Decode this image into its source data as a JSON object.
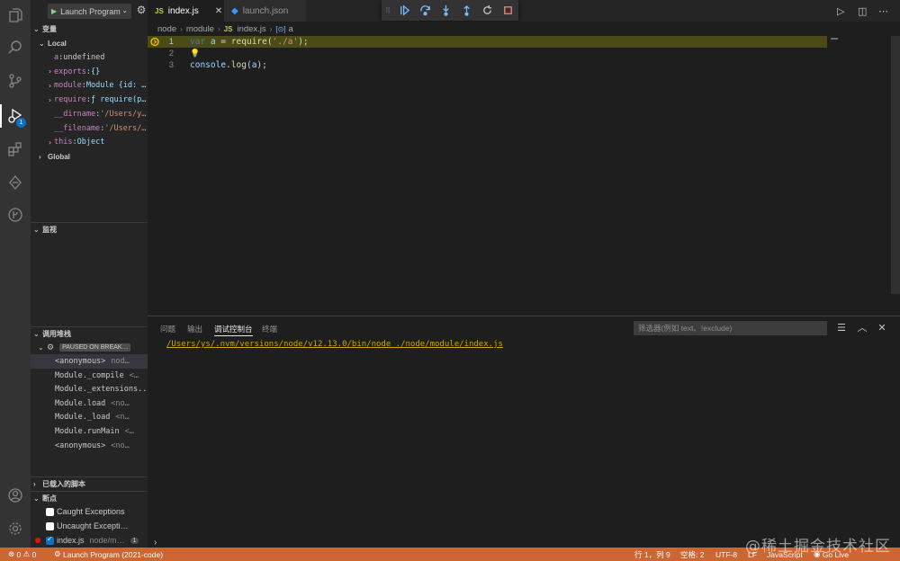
{
  "activity_bar": {
    "items": [
      {
        "icon": "files-icon"
      },
      {
        "icon": "search-icon"
      },
      {
        "icon": "source-control-icon"
      },
      {
        "icon": "run-debug-icon",
        "badge": "1"
      },
      {
        "icon": "extensions-icon"
      },
      {
        "icon": "remote-explorer-icon"
      },
      {
        "icon": "git-graph-icon"
      }
    ],
    "bottom": [
      {
        "icon": "account-icon"
      },
      {
        "icon": "manage-gear-icon"
      }
    ]
  },
  "debug": {
    "config_label": "Launch Program",
    "variables_title": "变量",
    "local_title": "Local",
    "global_title": "Global",
    "variables": [
      {
        "name": "a",
        "sep": ": ",
        "value": "undefined",
        "expandable": false
      },
      {
        "name": "exports",
        "sep": ": ",
        "value": "{}",
        "expandable": true
      },
      {
        "name": "module",
        "sep": ": ",
        "value": "Module {id: …",
        "expandable": true
      },
      {
        "name": "require",
        "sep": ": ",
        "value": "ƒ require(p…",
        "expandable": true
      },
      {
        "name": "__dirname",
        "sep": ": ",
        "value": "'/Users/y…",
        "expandable": false
      },
      {
        "name": "__filename",
        "sep": ": ",
        "value": "'/Users/…",
        "expandable": false
      },
      {
        "name": "this",
        "sep": ": ",
        "value": "Object",
        "expandable": true
      }
    ],
    "watch_title": "监视",
    "callstack_title": "调用堆栈",
    "paused_label": "PAUSED ON BREAK…",
    "frames": [
      {
        "fn": "<anonymous>",
        "src": "nod…"
      },
      {
        "fn": "Module._compile",
        "src": "<…"
      },
      {
        "fn": "Module._extensions..js",
        "src": ""
      },
      {
        "fn": "Module.load",
        "src": "<no…"
      },
      {
        "fn": "Module._load",
        "src": "<n…"
      },
      {
        "fn": "Module.runMain",
        "src": "<…"
      },
      {
        "fn": "<anonymous>",
        "src": "<no…"
      }
    ],
    "loaded_scripts_title": "已载入的脚本",
    "breakpoints_title": "断点",
    "breakpoints": [
      {
        "label": "Caught Exceptions",
        "checked": false
      },
      {
        "label": "Uncaught Excepti…",
        "checked": false
      },
      {
        "label": "index.js",
        "path": "node/m…",
        "count": "1",
        "checked": true
      }
    ]
  },
  "tabs": [
    {
      "label": "index.js",
      "type": "JS",
      "active": true
    },
    {
      "label": "launch.json",
      "type": "vscode",
      "active": false
    }
  ],
  "breadcrumb": [
    "node",
    "module",
    "index.js",
    "a"
  ],
  "editor": {
    "lines": [
      {
        "num": "1",
        "code": "var a = require('./a');"
      },
      {
        "num": "2",
        "code": ""
      },
      {
        "num": "3",
        "code": "console.log(a);"
      }
    ]
  },
  "panel": {
    "tabs": [
      "问题",
      "输出",
      "调试控制台",
      "终端"
    ],
    "active_tab": "调试控制台",
    "filter_placeholder": "筛选器(例如 text、!exclude)",
    "console_output": "/Users/ys/.nvm/versions/node/v12.13.0/bin/node ./node/module/index.js",
    "prompt": "›"
  },
  "statusbar": {
    "errors": "0",
    "warnings": "0",
    "launch": "Launch Program (2021-code)",
    "position": "行 1，列 9",
    "spaces": "空格: 2",
    "encoding": "UTF-8",
    "eol": "LF",
    "language": "JavaScript",
    "golive": "Go Live"
  },
  "watermark": "@稀土掘金技术社区",
  "colors": {
    "statusbar": "#cc6633",
    "highlight_line": "#4b4b18",
    "activity_bar": "#333333",
    "sidebar": "#252526",
    "editor": "#1e1e1e"
  }
}
